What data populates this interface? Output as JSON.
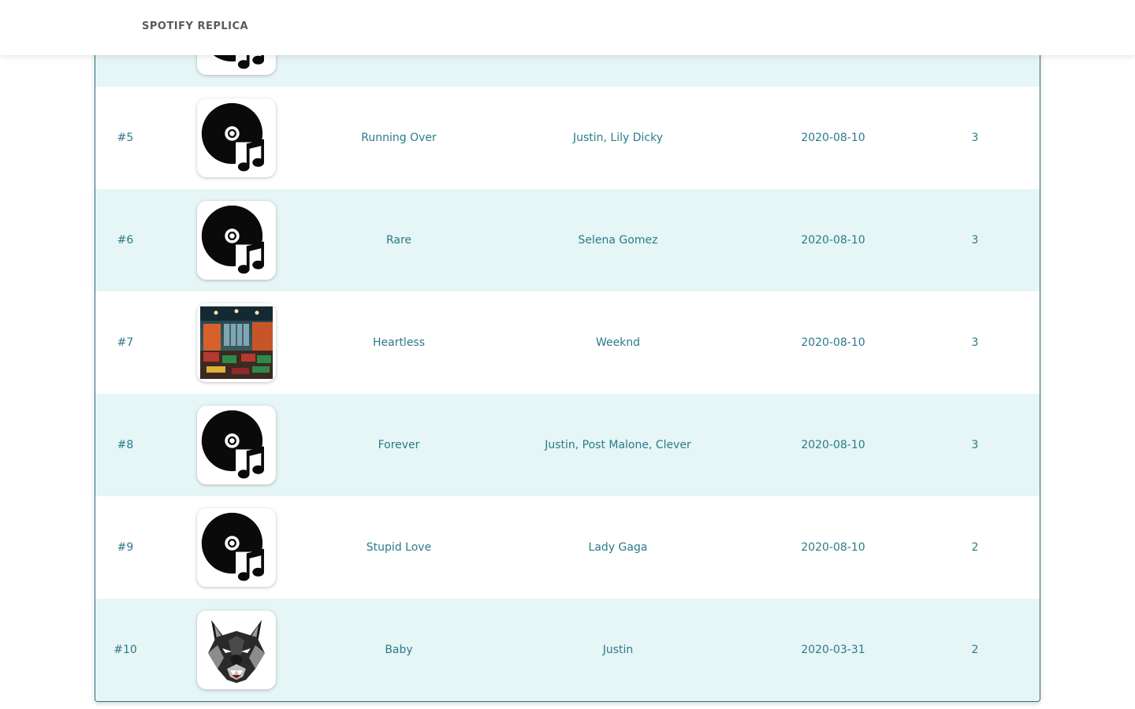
{
  "navbar": {
    "brand": "SPOTIFY REPLICA"
  },
  "tracks": [
    {
      "rank": "",
      "title": "",
      "artist": "",
      "date": "",
      "count": "",
      "cover": "disc-music-icon"
    },
    {
      "rank": "#5",
      "title": "Running Over",
      "artist": "Justin, Lily Dicky",
      "date": "2020-08-10",
      "count": "3",
      "cover": "disc-music-icon"
    },
    {
      "rank": "#6",
      "title": "Rare",
      "artist": "Selena Gomez",
      "date": "2020-08-10",
      "count": "3",
      "cover": "disc-music-icon"
    },
    {
      "rank": "#7",
      "title": "Heartless",
      "artist": "Weeknd",
      "date": "2020-08-10",
      "count": "3",
      "cover": "restaurant-photo"
    },
    {
      "rank": "#8",
      "title": "Forever",
      "artist": "Justin, Post Malone, Clever",
      "date": "2020-08-10",
      "count": "3",
      "cover": "disc-music-icon"
    },
    {
      "rank": "#9",
      "title": "Stupid Love",
      "artist": "Lady Gaga",
      "date": "2020-08-10",
      "count": "2",
      "cover": "disc-music-icon"
    },
    {
      "rank": "#10",
      "title": "Baby",
      "artist": "Justin",
      "date": "2020-03-31",
      "count": "2",
      "cover": "wolf-logo"
    }
  ],
  "colors": {
    "accent_text": "#2a7b88",
    "row_alt_bg": "#e6f5f6",
    "card_border": "#2f6f7e",
    "brand_text": "#5a5a5a"
  }
}
